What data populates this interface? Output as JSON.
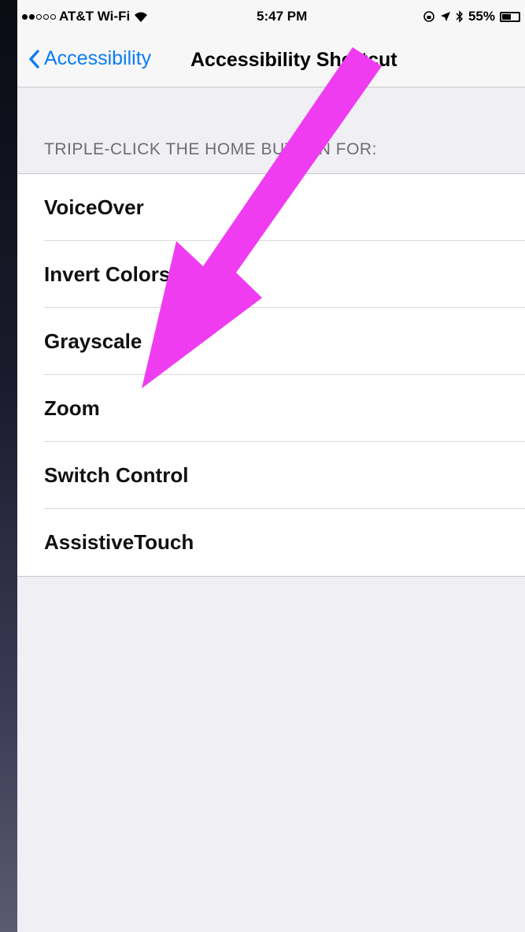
{
  "status_bar": {
    "carrier": "AT&T Wi-Fi",
    "time": "5:47 PM",
    "battery_percent": "55%",
    "battery_level": 0.55,
    "signal_bars_filled": 2,
    "signal_bars_total": 5,
    "icons": [
      "wifi-icon",
      "lock-rotation-icon",
      "location-icon",
      "bluetooth-icon",
      "battery-icon"
    ]
  },
  "nav": {
    "back_label": "Accessibility",
    "title": "Accessibility Shortcut"
  },
  "section": {
    "header": "TRIPLE-CLICK THE HOME BUTTON FOR:"
  },
  "options": [
    {
      "label": "VoiceOver"
    },
    {
      "label": "Invert Colors"
    },
    {
      "label": "Grayscale"
    },
    {
      "label": "Zoom"
    },
    {
      "label": "Switch Control"
    },
    {
      "label": "AssistiveTouch"
    }
  ],
  "colors": {
    "accent": "#0b7cf7",
    "annotation_arrow": "#f03cf0",
    "background": "#efeff4"
  }
}
